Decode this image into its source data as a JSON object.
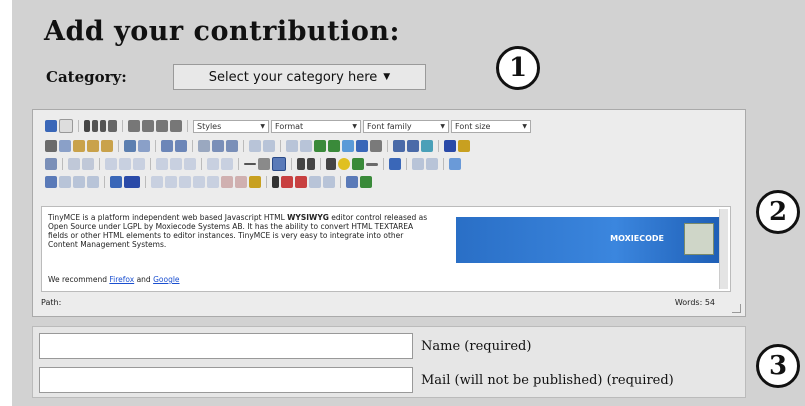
{
  "heading": "Add your contribution:",
  "category": {
    "label": "Category:",
    "selected": "Select your category here",
    "arrow": "▼"
  },
  "step_markers": [
    "1",
    "2",
    "3"
  ],
  "editor": {
    "toolbar": {
      "styles_label": "Styles",
      "format_label": "Format",
      "font_family_label": "Font family",
      "font_size_label": "Font size"
    },
    "content": {
      "paragraph_start": "TinyMCE is a platform independent web based Javascript HTML ",
      "paragraph_bold": "WYSIWYG",
      "paragraph_end": " editor control released as Open Source under LGPL by Moxiecode Systems AB. It has the ability to convert HTML TEXTAREA fields or other HTML elements to editor instances. TinyMCE is very easy to integrate into other Content Management Systems.",
      "recommend_prefix": "We recommend ",
      "link_firefox": "Firefox",
      "recommend_and": " and ",
      "link_google": "Google",
      "banner_text": "MOXIECODE"
    },
    "status": {
      "path_label": "Path:",
      "word_count": "Words: 54"
    }
  },
  "form": {
    "name_label": "Name (required)",
    "mail_label": "Mail (will not be published) (required)",
    "name_value": "",
    "mail_value": ""
  }
}
